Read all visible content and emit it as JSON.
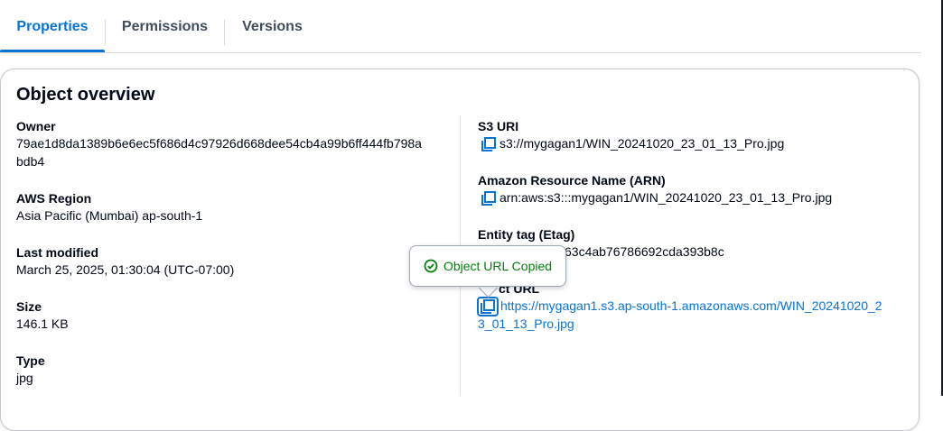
{
  "tabs": [
    {
      "label": "Properties",
      "active": true
    },
    {
      "label": "Permissions",
      "active": false
    },
    {
      "label": "Versions",
      "active": false
    }
  ],
  "overview": {
    "title": "Object overview",
    "owner": {
      "label": "Owner",
      "value_line1": "79ae1d8da1389b6e6ec5f686d4c97926d668dee54cb4a99b6ff444fb798a",
      "value_line2": "bdb4"
    },
    "region": {
      "label": "AWS Region",
      "value": "Asia Pacific (Mumbai) ap-south-1"
    },
    "last_modified": {
      "label": "Last modified",
      "value": "March 25, 2025, 01:30:04 (UTC-07:00)"
    },
    "size": {
      "label": "Size",
      "value": "146.1 KB"
    },
    "type": {
      "label": "Type",
      "value": "jpg"
    },
    "s3_uri": {
      "label": "S3 URI",
      "value": "s3://mygagan1/WIN_20241020_23_01_13_Pro.jpg"
    },
    "arn": {
      "label": "Amazon Resource Name (ARN)",
      "value": "arn:aws:s3:::mygagan1/WIN_20241020_23_01_13_Pro.jpg"
    },
    "etag": {
      "label": "Entity tag (Etag)",
      "value_visible": "63c4ab76786692cda393b8c"
    },
    "object_url": {
      "label_visible": "ct URL",
      "value_line1": "https://mygagan1.s3.ap-south-1.amazonaws.com/WIN_20241020_2",
      "value_line2": "3_01_13_Pro.jpg"
    }
  },
  "toast": {
    "message": "Object URL Copied",
    "icon": "check-circle-icon"
  },
  "colors": {
    "accent": "#0972d3",
    "success": "#037f0c",
    "text": "#000716"
  }
}
